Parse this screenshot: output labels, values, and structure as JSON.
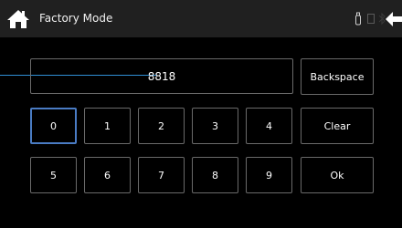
{
  "header": {
    "title": "Factory Mode",
    "icons": [
      "home-icon",
      "usb-icon",
      "battery-icon",
      "bluetooth-icon",
      "back-arrow-icon"
    ]
  },
  "display": {
    "value": "8818"
  },
  "keypad": {
    "row1": [
      "0",
      "1",
      "2",
      "3",
      "4"
    ],
    "row2": [
      "5",
      "6",
      "7",
      "8",
      "9"
    ],
    "selected_key": "0"
  },
  "actions": {
    "backspace_label": "Backspace",
    "clear_label": "Clear",
    "ok_label": "Ok"
  },
  "colors": {
    "background": "#000000",
    "header": "#202020",
    "border": "#6a6a6a",
    "selected_border": "#4a7cc4",
    "pointer_line": "#2f8fd5"
  }
}
